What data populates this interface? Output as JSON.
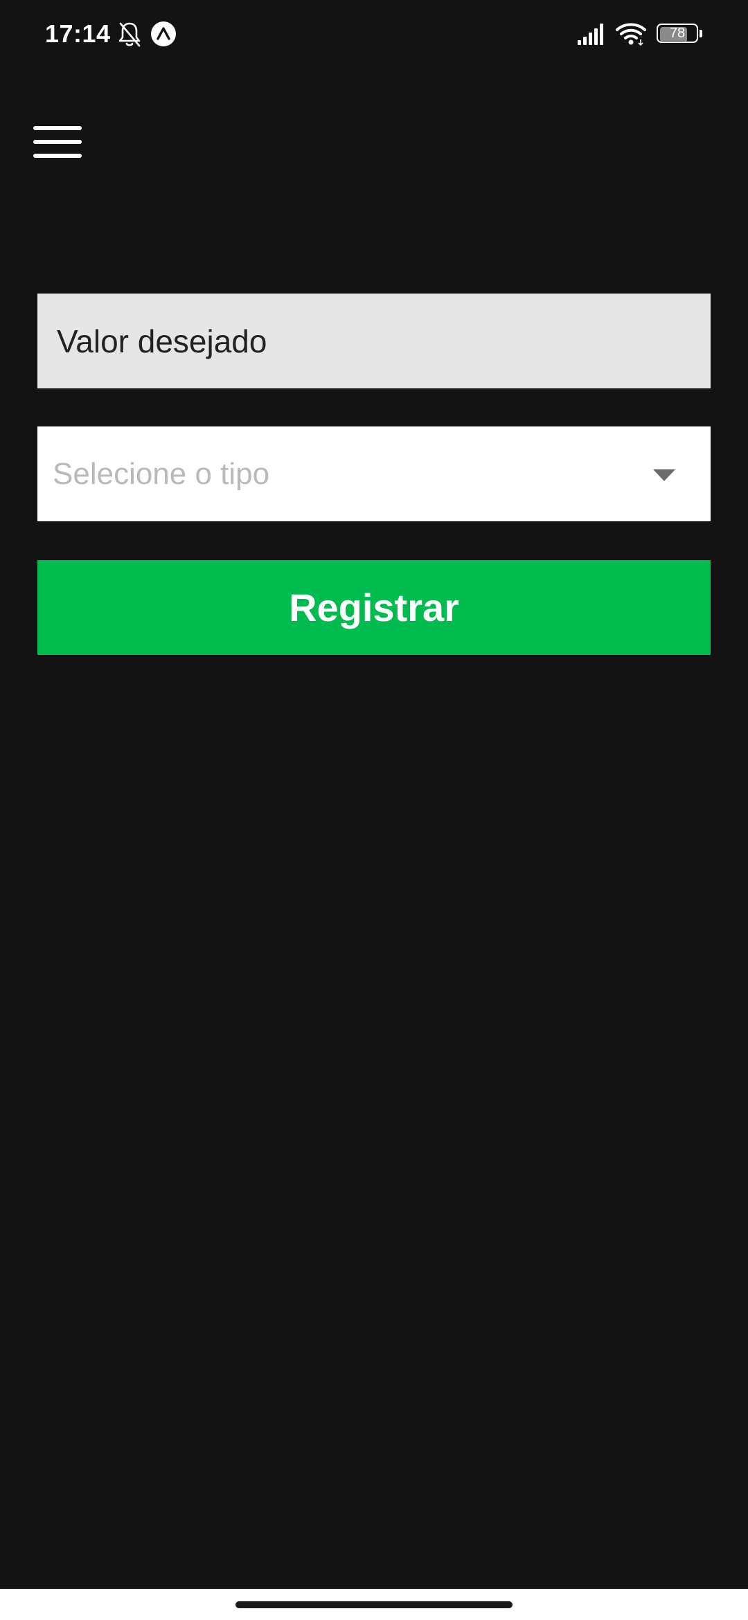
{
  "status_bar": {
    "time": "17:14",
    "battery_level": "78",
    "battery_fraction": 0.78,
    "icons": [
      "bell-muted-icon",
      "app-badge-icon",
      "signal-icon",
      "wifi-icon",
      "battery-icon"
    ]
  },
  "header": {
    "menu_icon": "hamburger-menu-icon"
  },
  "form": {
    "value_placeholder": "Valor desejado",
    "value": "",
    "type_placeholder": "Selecione o tipo",
    "register_label": "Registrar"
  },
  "colors": {
    "background": "#131313",
    "input_background": "#e6e6e6",
    "select_background": "#ffffff",
    "accent": "#00bb4d",
    "placeholder": "#b9b9b9"
  }
}
